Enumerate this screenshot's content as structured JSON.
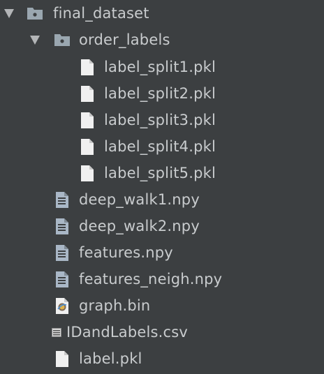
{
  "tree": {
    "root": {
      "label": "final_dataset",
      "expanded": true,
      "icon": "folder-icon"
    },
    "order_labels": {
      "label": "order_labels",
      "expanded": true,
      "icon": "folder-icon"
    },
    "split_files": [
      {
        "label": "label_split1.pkl",
        "icon": "file-icon"
      },
      {
        "label": "label_split2.pkl",
        "icon": "file-icon"
      },
      {
        "label": "label_split3.pkl",
        "icon": "file-icon"
      },
      {
        "label": "label_split4.pkl",
        "icon": "file-icon"
      },
      {
        "label": "label_split5.pkl",
        "icon": "file-icon"
      }
    ],
    "files": [
      {
        "label": "deep_walk1.npy",
        "icon": "text-file-icon"
      },
      {
        "label": "deep_walk2.npy",
        "icon": "text-file-icon"
      },
      {
        "label": "features.npy",
        "icon": "text-file-icon"
      },
      {
        "label": "features_neigh.npy",
        "icon": "text-file-icon"
      },
      {
        "label": "graph.bin",
        "icon": "binary-file-icon"
      },
      {
        "label": "IDandLabels.csv",
        "icon": "csv-file-icon"
      },
      {
        "label": "label.pkl",
        "icon": "file-icon"
      }
    ]
  },
  "colors": {
    "background": "#3c3f41",
    "text": "#c9ccce",
    "folder": "#9aa7b0",
    "file": "#f0f0f0"
  }
}
